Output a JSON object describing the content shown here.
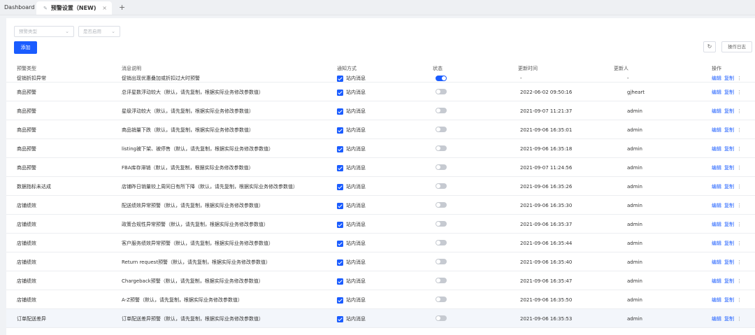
{
  "tabs": {
    "dashboard": "Dashboard",
    "active": "预警设置（NEW)",
    "close": "×",
    "add": "+"
  },
  "filters": {
    "type_placeholder": "预警类型",
    "enabled_placeholder": "是否启用"
  },
  "toolbar": {
    "add_label": "添加",
    "log_label": "操作日志"
  },
  "columns": {
    "type": "预警类型",
    "desc": "消息说明",
    "notify": "通知方式",
    "status": "状态",
    "updated": "更新时间",
    "updater": "更新人",
    "actions": "操作"
  },
  "actions": {
    "edit": "编辑",
    "copy": "复制"
  },
  "rows": [
    {
      "type": "促销折扣异常",
      "desc": "促销出现优惠叠加或折扣过大时预警",
      "notify": "站内消息",
      "on": true,
      "time": "-",
      "user": "-"
    },
    {
      "type": "商品预警",
      "desc": "总评星数浮动较大（默认，请先复制，根据实际业务修改参数值）",
      "notify": "站内消息",
      "on": false,
      "time": "2022-06-02 09:50:16",
      "user": "gjheart"
    },
    {
      "type": "商品预警",
      "desc": "星级浮动较大（默认，请先复制，根据实际业务修改参数值）",
      "notify": "站内消息",
      "on": false,
      "time": "2021-09-07 11:21:37",
      "user": "admin"
    },
    {
      "type": "商品预警",
      "desc": "商品销量下跌（默认，请先复制，根据实际业务修改参数值）",
      "notify": "站内消息",
      "on": false,
      "time": "2021-09-06 16:35:01",
      "user": "admin"
    },
    {
      "type": "商品预警",
      "desc": "listing被下架、被停售（默认，请先复制，根据实际业务修改参数值）",
      "notify": "站内消息",
      "on": false,
      "time": "2021-09-06 16:35:18",
      "user": "admin"
    },
    {
      "type": "商品预警",
      "desc": "FBA库存滞销（默认，请先复制，根据实际业务修改参数值）",
      "notify": "站内消息",
      "on": false,
      "time": "2021-09-07 11:24:56",
      "user": "admin"
    },
    {
      "type": "数据指标未达成",
      "desc": "店铺昨日销量较上周同日有所下降（默认，请先复制，根据实际业务修改参数值）",
      "notify": "站内消息",
      "on": false,
      "time": "2021-09-06 16:35:26",
      "user": "admin"
    },
    {
      "type": "店铺绩效",
      "desc": "配送绩效异常预警（默认，请先复制，根据实际业务修改参数值）",
      "notify": "站内消息",
      "on": false,
      "time": "2021-09-06 16:35:30",
      "user": "admin"
    },
    {
      "type": "店铺绩效",
      "desc": "政策合规性异常预警（默认，请先复制，根据实际业务修改参数值）",
      "notify": "站内消息",
      "on": false,
      "time": "2021-09-06 16:35:37",
      "user": "admin"
    },
    {
      "type": "店铺绩效",
      "desc": "客户服务绩效异常预警（默认，请先复制，根据实际业务修改参数值）",
      "notify": "站内消息",
      "on": false,
      "time": "2021-09-06 16:35:44",
      "user": "admin"
    },
    {
      "type": "店铺绩效",
      "desc": "Return request预警（默认，请先复制，根据实际业务修改参数值）",
      "notify": "站内消息",
      "on": false,
      "time": "2021-09-06 16:35:40",
      "user": "admin"
    },
    {
      "type": "店铺绩效",
      "desc": "Chargeback预警（默认，请先复制，根据实际业务修改参数值）",
      "notify": "站内消息",
      "on": false,
      "time": "2021-09-06 16:35:47",
      "user": "admin"
    },
    {
      "type": "店铺绩效",
      "desc": "A-Z预警（默认，请先复制，根据实际业务修改参数值）",
      "notify": "站内消息",
      "on": false,
      "time": "2021-09-06 16:35:50",
      "user": "admin"
    },
    {
      "type": "订单配送差异",
      "desc": "订单配送差异预警（默认，请先复制，根据实际业务修改参数值）",
      "notify": "站内消息",
      "on": false,
      "time": "2021-09-06 16:35:53",
      "user": "admin"
    }
  ]
}
